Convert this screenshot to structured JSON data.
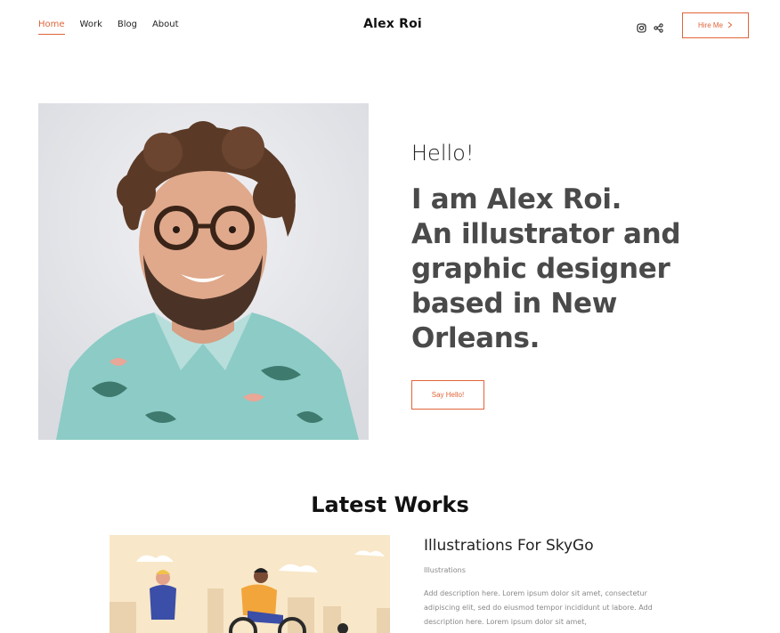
{
  "nav": {
    "items": [
      {
        "label": "Home",
        "active": true
      },
      {
        "label": "Work",
        "active": false
      },
      {
        "label": "Blog",
        "active": false
      },
      {
        "label": "About",
        "active": false
      }
    ]
  },
  "brand": {
    "name": "Alex Roi"
  },
  "header": {
    "icons": [
      "instagram-icon",
      "share-icon"
    ],
    "hire_label": "Hire Me"
  },
  "hero": {
    "greeting": "Hello!",
    "headline_lines": [
      "I am Alex Roi.",
      "An illustrator and",
      "graphic designer",
      "based in New",
      "Orleans."
    ],
    "cta_label": "Say Hello!"
  },
  "works": {
    "section_title": "Latest Works",
    "items": [
      {
        "title": "Illustrations For SkyGo",
        "category": "Illustrations",
        "description": "Add description here. Lorem ipsum dolor sit amet, consectetur adipiscing elit, sed do eiusmod tempor incididunt ut labore. Add description here. Lorem ipsum dolor sit amet,"
      }
    ]
  },
  "colors": {
    "accent": "#e0653a",
    "text": "#111111",
    "headline": "#4a4a4a",
    "muted": "#888888"
  }
}
